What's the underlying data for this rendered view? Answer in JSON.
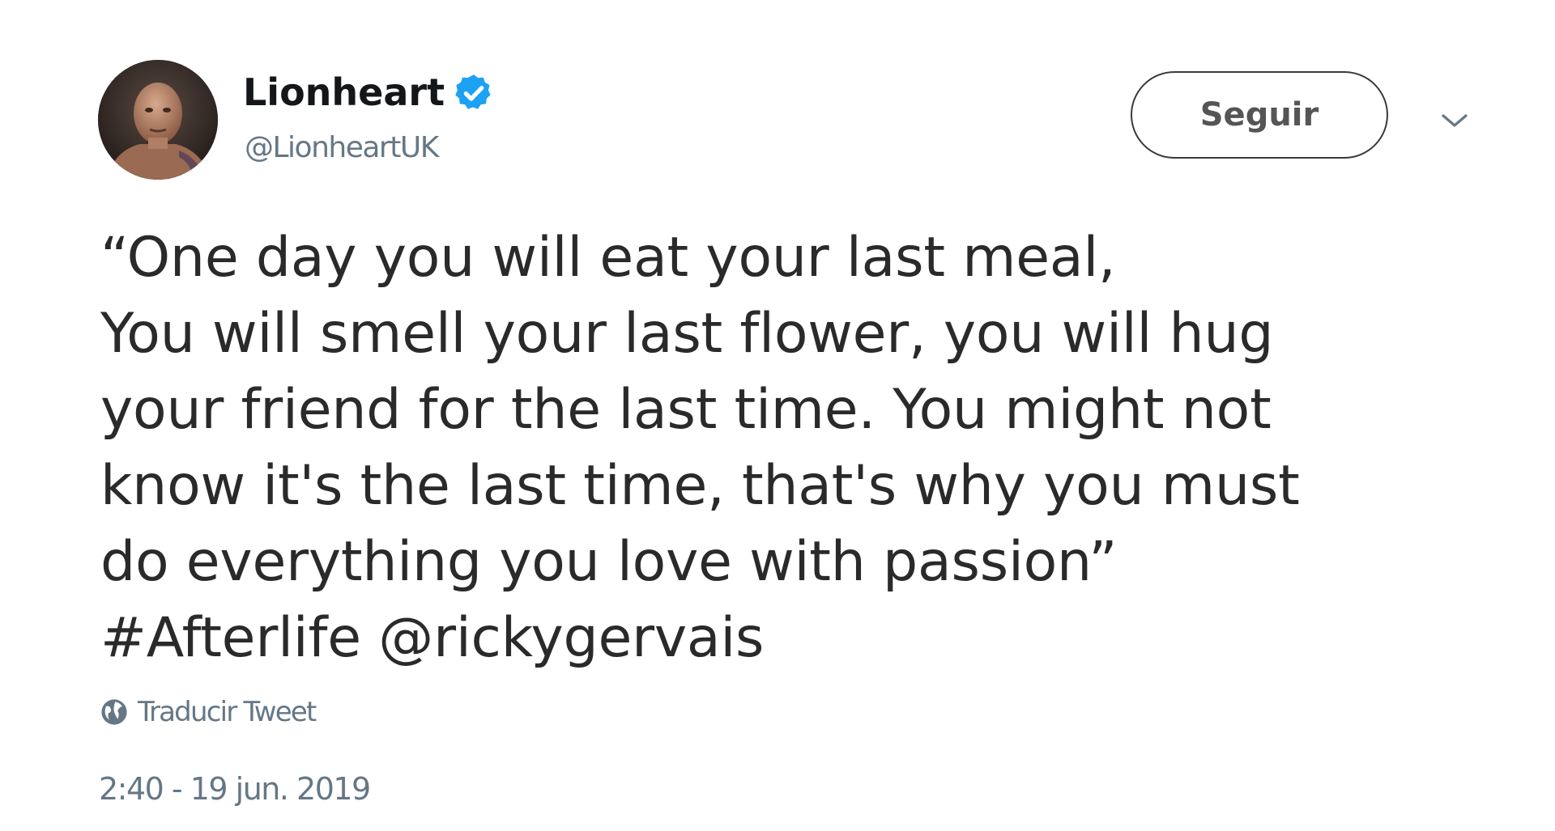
{
  "author": {
    "display_name": "Lionheart",
    "handle": "@LionheartUK",
    "verified": true,
    "avatar_icon": "avatar-photo"
  },
  "actions": {
    "follow_label": "Seguir",
    "menu_icon": "chevron-down-icon"
  },
  "tweet": {
    "lines": [
      "“One day you will eat your last meal,",
      "You will smell your last flower, you will hug",
      "your friend for the last time. You might not",
      "know it's the last time, that's why you must",
      "do everything you love with passion”"
    ],
    "hashtag": "#Afterlife",
    "mention": "@rickygervais"
  },
  "translate": {
    "label": "Traducir Tweet",
    "icon": "globe-icon"
  },
  "timestamp": "2:40 - 19 jun. 2019",
  "colors": {
    "verified": "#1da1f2",
    "secondary_text": "#657786",
    "primary_text": "#14171a"
  }
}
